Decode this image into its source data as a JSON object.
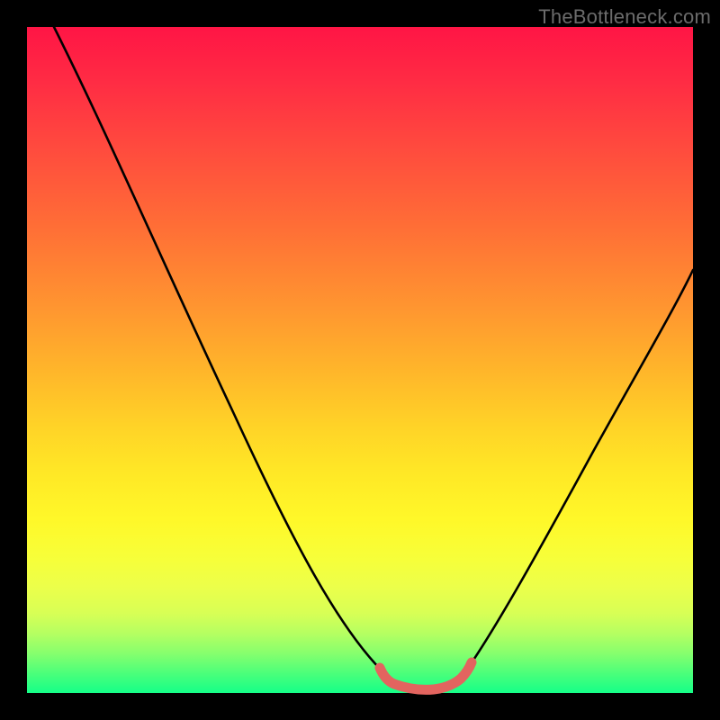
{
  "watermark": "TheBottleneck.com",
  "colors": {
    "frame": "#000000",
    "curve": "#000000",
    "marker": "#e3645f",
    "gradient_top": "#ff1545",
    "gradient_bottom": "#15ff88"
  },
  "chart_data": {
    "type": "line",
    "title": "",
    "xlabel": "",
    "ylabel": "",
    "xlim": [
      0,
      100
    ],
    "ylim": [
      0,
      100
    ],
    "grid": false,
    "legend": false,
    "series": [
      {
        "name": "left-curve",
        "x": [
          4,
          10,
          18,
          26,
          34,
          42,
          48,
          52,
          55
        ],
        "values": [
          100,
          86,
          70,
          54,
          38,
          21,
          9,
          3,
          1
        ]
      },
      {
        "name": "valley-floor",
        "x": [
          55,
          58,
          61,
          63,
          65
        ],
        "values": [
          1,
          0.5,
          0.5,
          0.7,
          1.2
        ]
      },
      {
        "name": "right-curve",
        "x": [
          65,
          70,
          76,
          82,
          88,
          94,
          100
        ],
        "values": [
          1.2,
          6,
          17,
          30,
          44,
          56,
          65
        ]
      }
    ],
    "annotations": [
      {
        "name": "valley-highlight",
        "x_range": [
          53,
          66
        ],
        "y": 1,
        "color": "#e3645f"
      }
    ]
  }
}
